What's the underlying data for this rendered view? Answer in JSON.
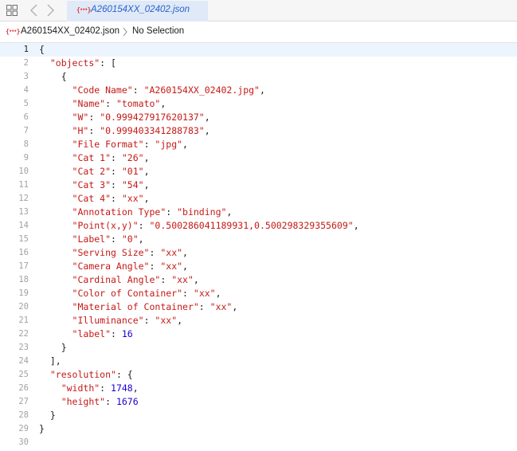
{
  "tab": {
    "title": "A260154XX_02402.json",
    "icon": "json-file-icon"
  },
  "breadcrumb": {
    "file": "A260154XX_02402.json",
    "selection": "No Selection"
  },
  "colors": {
    "string": "#c41a16",
    "number": "#1c00cf",
    "plain": "#1b1b1b",
    "tab_active_bg": "#dfe9f8",
    "tab_title": "#2a62c9",
    "json_icon": "#e2373a",
    "current_line_bg": "#ecf5fe"
  },
  "editor": {
    "current_line": 1,
    "lines": [
      [
        [
          "p",
          "{"
        ]
      ],
      [
        [
          "i",
          "  "
        ],
        [
          "s",
          "\"objects\""
        ],
        [
          "p",
          ": ["
        ]
      ],
      [
        [
          "i",
          "    "
        ],
        [
          "p",
          "{"
        ]
      ],
      [
        [
          "i",
          "      "
        ],
        [
          "s",
          "\"Code Name\""
        ],
        [
          "p",
          ": "
        ],
        [
          "s",
          "\"A260154XX_02402.jpg\""
        ],
        [
          "p",
          ","
        ]
      ],
      [
        [
          "i",
          "      "
        ],
        [
          "s",
          "\"Name\""
        ],
        [
          "p",
          ": "
        ],
        [
          "s",
          "\"tomato\""
        ],
        [
          "p",
          ","
        ]
      ],
      [
        [
          "i",
          "      "
        ],
        [
          "s",
          "\"W\""
        ],
        [
          "p",
          ": "
        ],
        [
          "s",
          "\"0.999427917620137\""
        ],
        [
          "p",
          ","
        ]
      ],
      [
        [
          "i",
          "      "
        ],
        [
          "s",
          "\"H\""
        ],
        [
          "p",
          ": "
        ],
        [
          "s",
          "\"0.999403341288783\""
        ],
        [
          "p",
          ","
        ]
      ],
      [
        [
          "i",
          "      "
        ],
        [
          "s",
          "\"File Format\""
        ],
        [
          "p",
          ": "
        ],
        [
          "s",
          "\"jpg\""
        ],
        [
          "p",
          ","
        ]
      ],
      [
        [
          "i",
          "      "
        ],
        [
          "s",
          "\"Cat 1\""
        ],
        [
          "p",
          ": "
        ],
        [
          "s",
          "\"26\""
        ],
        [
          "p",
          ","
        ]
      ],
      [
        [
          "i",
          "      "
        ],
        [
          "s",
          "\"Cat 2\""
        ],
        [
          "p",
          ": "
        ],
        [
          "s",
          "\"01\""
        ],
        [
          "p",
          ","
        ]
      ],
      [
        [
          "i",
          "      "
        ],
        [
          "s",
          "\"Cat 3\""
        ],
        [
          "p",
          ": "
        ],
        [
          "s",
          "\"54\""
        ],
        [
          "p",
          ","
        ]
      ],
      [
        [
          "i",
          "      "
        ],
        [
          "s",
          "\"Cat 4\""
        ],
        [
          "p",
          ": "
        ],
        [
          "s",
          "\"xx\""
        ],
        [
          "p",
          ","
        ]
      ],
      [
        [
          "i",
          "      "
        ],
        [
          "s",
          "\"Annotation Type\""
        ],
        [
          "p",
          ": "
        ],
        [
          "s",
          "\"binding\""
        ],
        [
          "p",
          ","
        ]
      ],
      [
        [
          "i",
          "      "
        ],
        [
          "s",
          "\"Point(x,y)\""
        ],
        [
          "p",
          ": "
        ],
        [
          "s",
          "\"0.500286041189931,0.500298329355609\""
        ],
        [
          "p",
          ","
        ]
      ],
      [
        [
          "i",
          "      "
        ],
        [
          "s",
          "\"Label\""
        ],
        [
          "p",
          ": "
        ],
        [
          "s",
          "\"0\""
        ],
        [
          "p",
          ","
        ]
      ],
      [
        [
          "i",
          "      "
        ],
        [
          "s",
          "\"Serving Size\""
        ],
        [
          "p",
          ": "
        ],
        [
          "s",
          "\"xx\""
        ],
        [
          "p",
          ","
        ]
      ],
      [
        [
          "i",
          "      "
        ],
        [
          "s",
          "\"Camera Angle\""
        ],
        [
          "p",
          ": "
        ],
        [
          "s",
          "\"xx\""
        ],
        [
          "p",
          ","
        ]
      ],
      [
        [
          "i",
          "      "
        ],
        [
          "s",
          "\"Cardinal Angle\""
        ],
        [
          "p",
          ": "
        ],
        [
          "s",
          "\"xx\""
        ],
        [
          "p",
          ","
        ]
      ],
      [
        [
          "i",
          "      "
        ],
        [
          "s",
          "\"Color of Container\""
        ],
        [
          "p",
          ": "
        ],
        [
          "s",
          "\"xx\""
        ],
        [
          "p",
          ","
        ]
      ],
      [
        [
          "i",
          "      "
        ],
        [
          "s",
          "\"Material of Container\""
        ],
        [
          "p",
          ": "
        ],
        [
          "s",
          "\"xx\""
        ],
        [
          "p",
          ","
        ]
      ],
      [
        [
          "i",
          "      "
        ],
        [
          "s",
          "\"Illuminance\""
        ],
        [
          "p",
          ": "
        ],
        [
          "s",
          "\"xx\""
        ],
        [
          "p",
          ","
        ]
      ],
      [
        [
          "i",
          "      "
        ],
        [
          "s",
          "\"label\""
        ],
        [
          "p",
          ": "
        ],
        [
          "n",
          "16"
        ]
      ],
      [
        [
          "i",
          "    "
        ],
        [
          "p",
          "}"
        ]
      ],
      [
        [
          "i",
          "  "
        ],
        [
          "p",
          "],"
        ]
      ],
      [
        [
          "i",
          "  "
        ],
        [
          "s",
          "\"resolution\""
        ],
        [
          "p",
          ": {"
        ]
      ],
      [
        [
          "i",
          "    "
        ],
        [
          "s",
          "\"width\""
        ],
        [
          "p",
          ": "
        ],
        [
          "n",
          "1748"
        ],
        [
          "p",
          ","
        ]
      ],
      [
        [
          "i",
          "    "
        ],
        [
          "s",
          "\"height\""
        ],
        [
          "p",
          ": "
        ],
        [
          "n",
          "1676"
        ]
      ],
      [
        [
          "i",
          "  "
        ],
        [
          "p",
          "}"
        ]
      ],
      [
        [
          "p",
          "}"
        ]
      ],
      []
    ]
  }
}
